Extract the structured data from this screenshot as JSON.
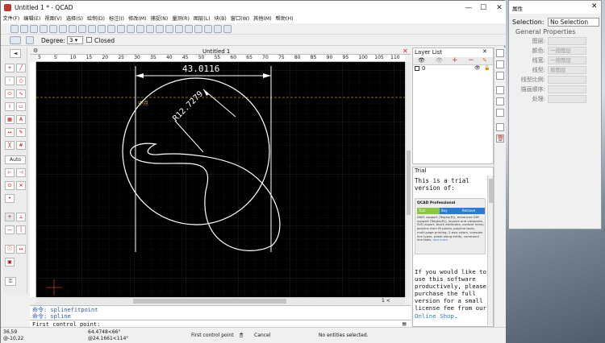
{
  "window": {
    "title": "Untitled 1 * - QCAD"
  },
  "menu": [
    "文件(F)",
    "编辑(E)",
    "视图(V)",
    "选择(S)",
    "绘制(D)",
    "标注(I)",
    "修改(M)",
    "捕捉(N)",
    "量测(R)",
    "图层(L)",
    "块(B)",
    "窗口(W)",
    "其他(M)",
    "帮助(H)"
  ],
  "options": {
    "degree_label": "Degree:",
    "degree_value": "3",
    "closed_label": "Closed"
  },
  "document": {
    "tab_title": "Untitled 1",
    "ruler_ticks": [
      "5",
      "5",
      "10",
      "15",
      "20",
      "25",
      "30",
      "35",
      "40",
      "45",
      "50",
      "55",
      "60",
      "65",
      "70",
      "75",
      "80",
      "85",
      "90",
      "95",
      "100",
      "105",
      "110"
    ]
  },
  "drawing": {
    "dim_horizontal": "43.0116",
    "dim_radius": "R12.7279",
    "point_label": "中点"
  },
  "command": {
    "history1": "命令: splinefitpoint",
    "history2": "命令: spline",
    "prompt": "First control point:"
  },
  "layers": {
    "title": "Layer List",
    "layer0": "0"
  },
  "trial": {
    "title": "Trial",
    "intro": "This is a trial version of:",
    "product": "QCAD Professional",
    "tabs": [
      "Trial",
      "Buy",
      "Remove"
    ],
    "features": "DWG support (Teigha(R)), enhanced DXF support (Teigha(R)), layouts and viewports, SVG export, block attributes, context menu, polyline from fit points, polyline tools, multi-page printing, 2-axis colors, complex line types, paste along entity, command line tools,",
    "features_link": "and more",
    "body": "If you would like to use this software productively, please purchase the full version for a small license fee from our",
    "link": "Online Shop",
    "end": "."
  },
  "status": {
    "coord1": "36,59",
    "coord2": "@-10,22",
    "coord3": "64.4748<66°",
    "coord4": "@24.1661<114°",
    "hint_left": "First control point",
    "hint_right": "Cancel",
    "selection": "No entities selected."
  },
  "properties": {
    "title": "属性",
    "selection_label": "Selection:",
    "selection_value": "No Selection",
    "section": "General Properties",
    "rows": [
      {
        "label": "图层:",
        "value": ""
      },
      {
        "label": "颜色:",
        "value": "一按图层"
      },
      {
        "label": "线宽:",
        "value": "一按图层"
      },
      {
        "label": "线型:",
        "value": "按图层"
      },
      {
        "label": "线型比例:",
        "value": ""
      },
      {
        "label": "描画顺序:",
        "value": ""
      },
      {
        "label": "处理:",
        "value": ""
      }
    ]
  },
  "left_tools": {
    "auto": "Auto"
  },
  "colors": {
    "canvas": "#000000",
    "grid": "#2a2a2a",
    "entity": "#ffffff",
    "accent": "#c0392b",
    "panel_blue": "#2b7cd6",
    "panel_green": "#8dc63f"
  }
}
